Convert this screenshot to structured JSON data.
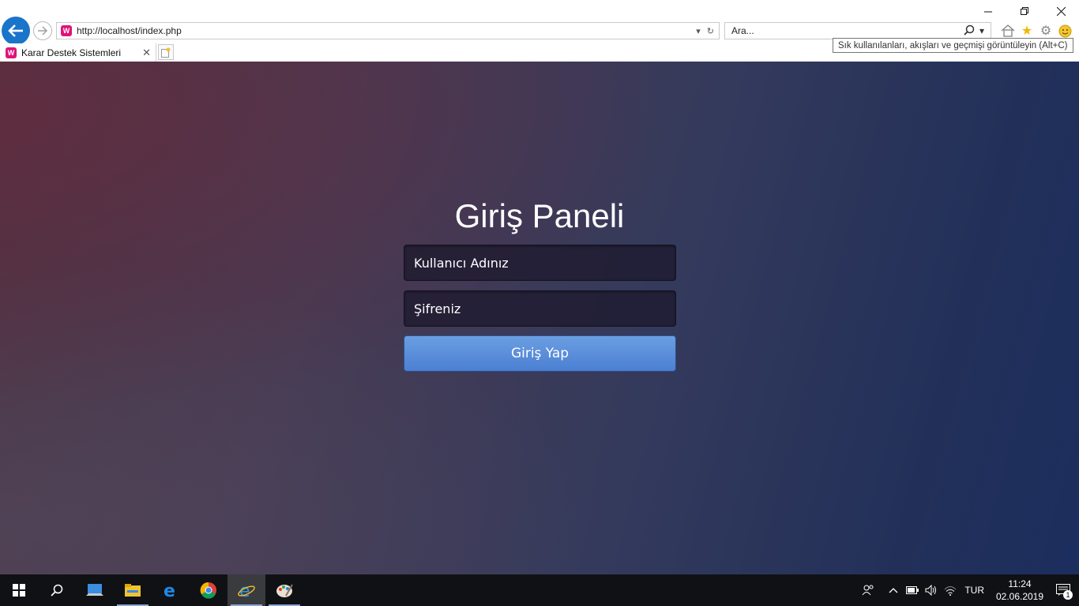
{
  "browser": {
    "address": "http://localhost/index.php",
    "search_placeholder": "Ara...",
    "tab_title": "Karar Destek Sistemleri",
    "favicon_letter": "W",
    "tooltip": "Sık kullanılanları, akışları ve geçmişi görüntüleyin (Alt+C)",
    "window_controls": [
      "minimize-icon",
      "restore-icon",
      "close-icon"
    ],
    "toolbar_icons": [
      "home-icon",
      "favorites-star-icon",
      "settings-gear-icon",
      "feedback-smiley-icon"
    ]
  },
  "login": {
    "title": "Giriş Paneli",
    "username_placeholder": "Kullanıcı Adınız",
    "password_placeholder": "Şifreniz",
    "submit_label": "Giriş Yap",
    "colors": {
      "button": "#5a8edb",
      "text": "#ffffff"
    }
  },
  "taskbar": {
    "apps": [
      "start-icon",
      "search-icon",
      "this-pc-icon",
      "file-explorer-icon",
      "edge-icon",
      "chrome-icon",
      "internet-explorer-icon",
      "paint-icon"
    ],
    "language": "TUR",
    "time": "11:24",
    "date": "02.06.2019",
    "notification_count": "1"
  }
}
